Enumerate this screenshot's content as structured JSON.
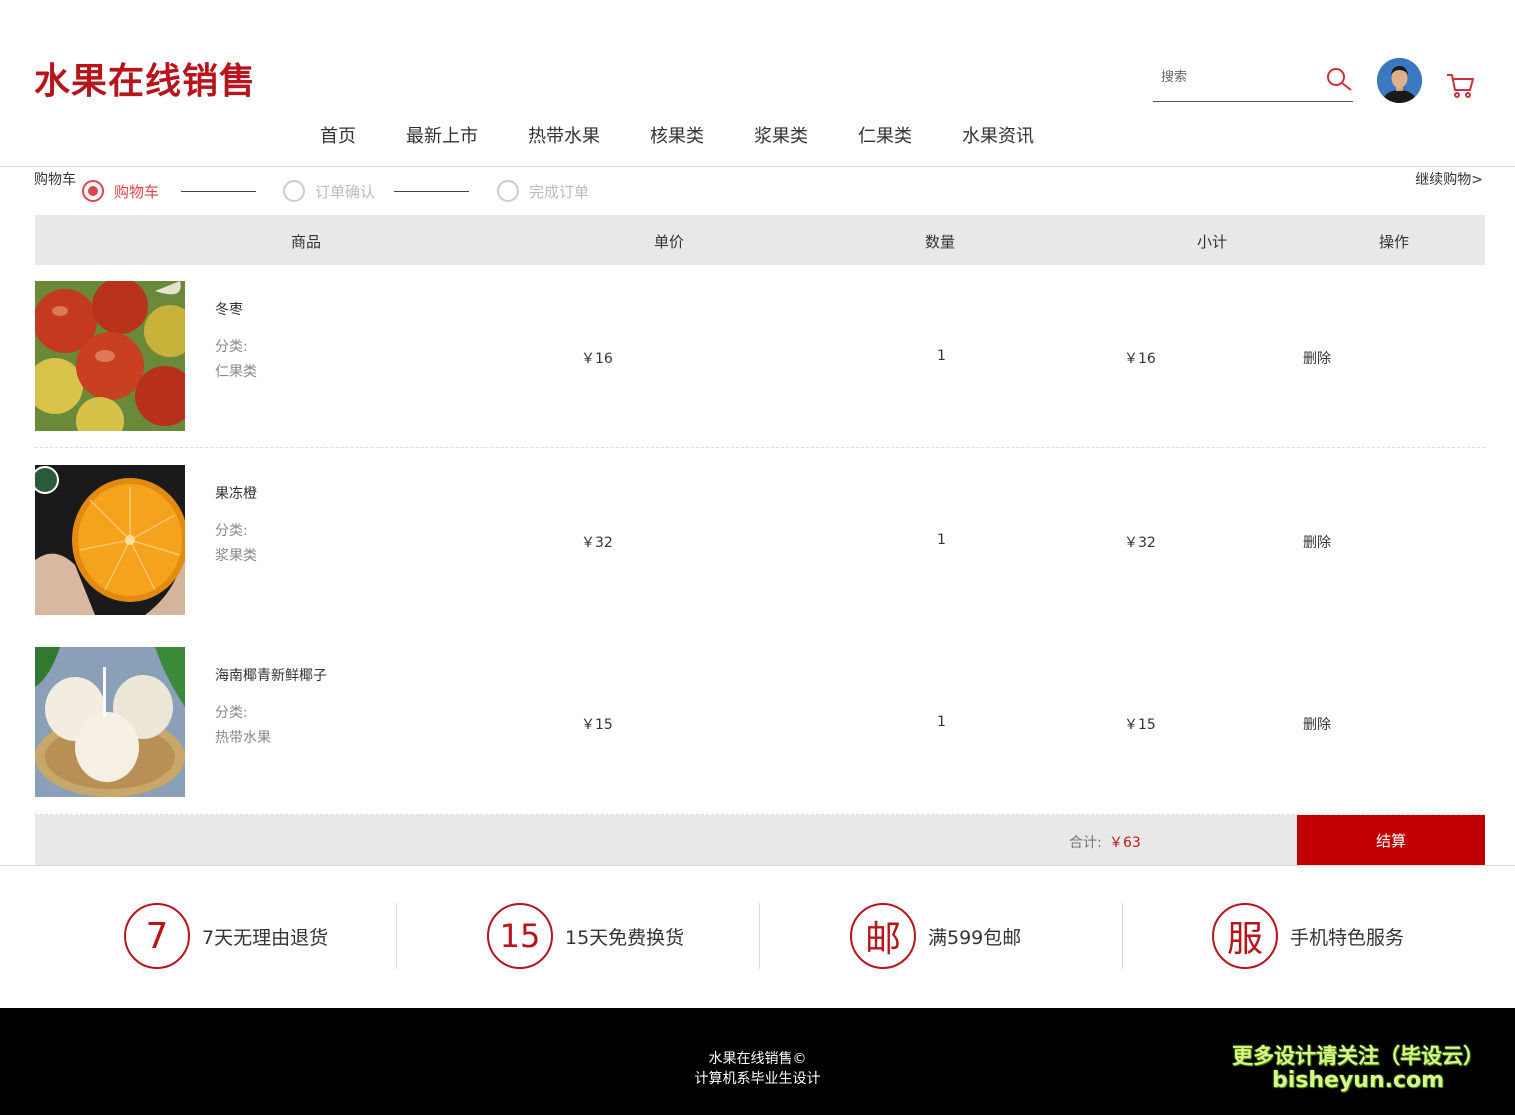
{
  "header": {
    "logo": "水果在线销售",
    "search_placeholder": "搜索",
    "nav": [
      "首页",
      "最新上市",
      "热带水果",
      "核果类",
      "浆果类",
      "仁果类",
      "水果资讯"
    ]
  },
  "steps": {
    "crumb": "购物车",
    "continue": "继续购物>",
    "items": [
      {
        "label": "购物车",
        "active": true
      },
      {
        "label": "订单确认",
        "active": false
      },
      {
        "label": "完成订单",
        "active": false
      }
    ]
  },
  "table": {
    "headers": [
      "商品",
      "单价",
      "数量",
      "小计",
      "操作"
    ],
    "rows": [
      {
        "name": "冬枣",
        "cat_label": "分类:",
        "category": "仁果类",
        "price": "￥16",
        "qty": "1",
        "subtotal": "￥16",
        "action": "删除"
      },
      {
        "name": "果冻橙",
        "cat_label": "分类:",
        "category": "浆果类",
        "price": "￥32",
        "qty": "1",
        "subtotal": "￥32",
        "action": "删除"
      },
      {
        "name": "海南椰青新鲜椰子",
        "cat_label": "分类:",
        "category": "热带水果",
        "price": "￥15",
        "qty": "1",
        "subtotal": "￥15",
        "action": "删除"
      }
    ]
  },
  "total": {
    "label": "合计:",
    "value": "￥63",
    "checkout": "结算"
  },
  "services": [
    {
      "icon": "7",
      "text": "7天无理由退货"
    },
    {
      "icon": "15",
      "text": "15天免费换货"
    },
    {
      "icon": "邮",
      "text": "满599包邮"
    },
    {
      "icon": "服",
      "text": "手机特色服务"
    }
  ],
  "footer": {
    "line1": "水果在线销售©",
    "line2": "计算机系毕业生设计",
    "promo1": "更多设计请关注（毕设云）",
    "promo2": "bisheyun.com"
  },
  "colors": {
    "brand": "#b8141b",
    "checkout": "#c00000",
    "active_step": "#e0444b"
  }
}
